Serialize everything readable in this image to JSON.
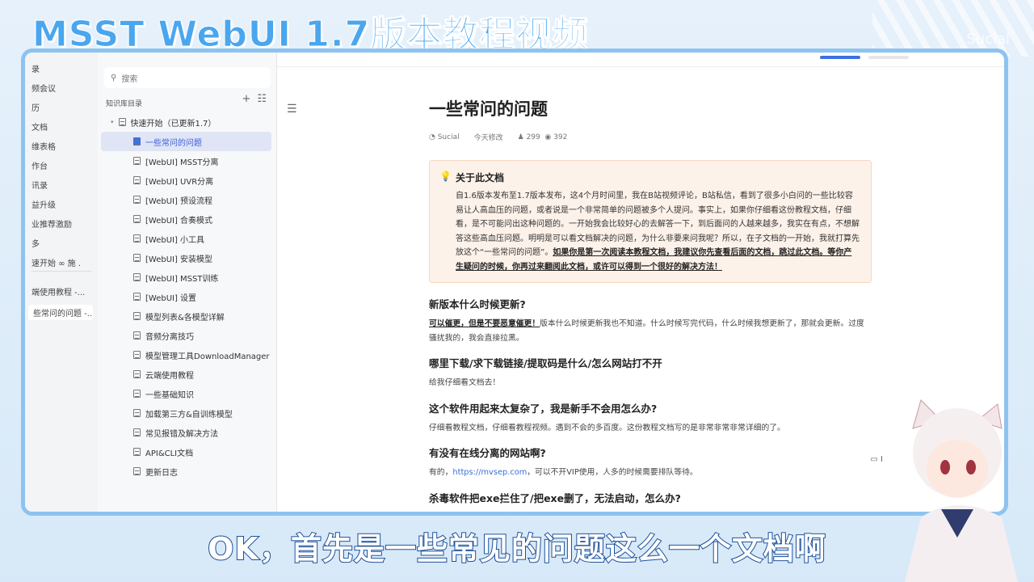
{
  "video": {
    "title": "MSST WebUI 1.7版本教程视频",
    "watermark": "Sucial",
    "subtitle": "OK，首先是一些常见的问题这么一个文档啊"
  },
  "left_nav": [
    "录",
    "频会议",
    "历",
    "文档",
    "维表格",
    "作台",
    "讯录",
    "益升级",
    "业推荐激励",
    "多",
    "速开始 ∞ 施 .",
    "端使用教程 -...",
    "些常问的问题 -..."
  ],
  "sidebar": {
    "search_placeholder": "搜索",
    "header": "知识库目录",
    "add": "+",
    "toggle": "☷",
    "root": "快速开始（已更新1.7）",
    "items": [
      "一些常问的问题",
      "[WebUI] MSST分离",
      "[WebUI] UVR分离",
      "[WebUI] 预设流程",
      "[WebUI] 合奏模式",
      "[WebUI] 小工具",
      "[WebUI] 安装模型",
      "[WebUI] MSST训练",
      "[WebUI] 设置",
      "模型列表&各模型详解",
      "音频分离技巧",
      "模型管理工具DownloadManager",
      "云端使用教程",
      "一些基础知识",
      "加载第三方&自训练模型",
      "常见报错及解决方法",
      "API&CLI文档",
      "更新日志"
    ]
  },
  "doc": {
    "title": "一些常问的问题",
    "author": "Sucial",
    "modified": "今天修改",
    "readers": "299",
    "views": "392",
    "callout": {
      "title": "关于此文档",
      "text": "自1.6版本发布至1.7版本发布，这4个月时间里，我在B站视频评论，B站私信，看到了很多小白问的一些比较容易让人高血压的问题，或者说是一个非常简单的问题被多个人提问。事实上，如果你仔细看这份教程文档，仔细看，是不可能问出这种问题的。一开始我会比较好心的去解答一下，到后面问的人越来越多，我实在有点，不想解答这些高血压问题。明明是可以看文档解决的问题，为什么非要来问我呢？所以，在子文档的一开始，我就打算先放这个“一些常问的问题”。",
      "emphasis": "如果你是第一次阅读本教程文档，我建议你先查看后面的文档，跳过此文档。等你产生疑问的时候，你再过来翻阅此文档，或许可以得到一个很好的解决方法！"
    },
    "sections": [
      {
        "q": "新版本什么时候更新?",
        "bold": "可以催更，但是不要恶意催更！",
        "a": "版本什么时候更新我也不知道。什么时候写完代码，什么时候我想更新了，那就会更新。过度骚扰我的，我会直接拉黑。"
      },
      {
        "q": "哪里下载/求下载链接/提取码是什么/怎么网站打不开",
        "a": "给我仔细看文档去！"
      },
      {
        "q": "这个软件用起来太复杂了，我是新手不会用怎么办?",
        "a": "仔细看教程文档，仔细看教程视频。遇到不会的多百度。这份教程文档写的是非常非常非常详细的了。"
      },
      {
        "q": "有没有在线分离的网站啊?",
        "pre": "有的，",
        "link": "https://mvsep.com",
        "a": "，可以不开VIP使用，人多的时候需要排队等待。"
      },
      {
        "q": "杀毒软件把exe拦住了/把exe删了，无法启动，怎么办?"
      }
    ]
  }
}
